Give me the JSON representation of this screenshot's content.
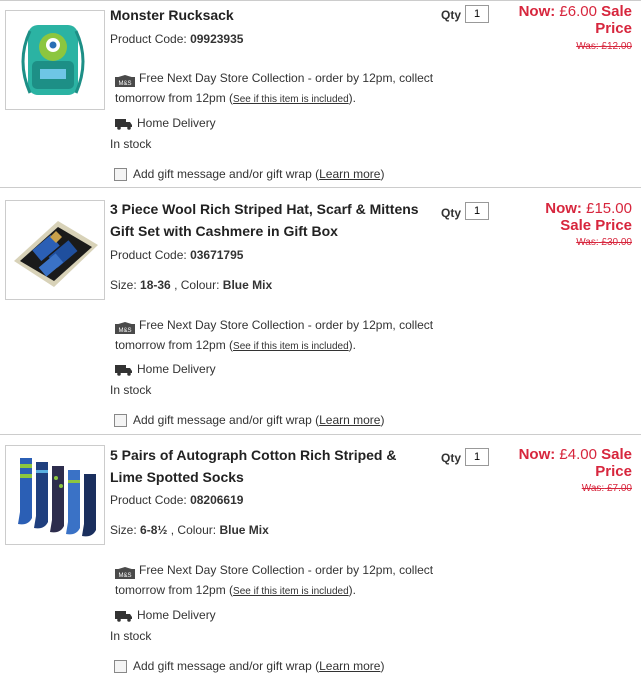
{
  "qty_label": "Qty",
  "now_label": "Now:",
  "sale_label": "Sale",
  "sale_price_label": "Sale Price",
  "was_label": "Was:",
  "product_code_label": "Product Code:",
  "collect_text_1": "Free Next Day Store Collection - order by 12pm, collect",
  "collect_text_2": "tomorrow from 12pm (",
  "collect_link": "See if this item is included",
  "collect_text_3": ").",
  "home_delivery": "Home Delivery",
  "in_stock": "In stock",
  "gift_text": "Add gift message and/or gift wrap (",
  "gift_learn": "Learn more",
  "gift_close": ")",
  "size_label": "Size:",
  "colour_label": ", Colour:",
  "ms_logo_text": "M&S",
  "colors": {
    "price_red": "#d7263d",
    "border": "#cccccc"
  },
  "items": [
    {
      "title": "Monster Rucksack",
      "code": "09923935",
      "qty": "1",
      "now_price": "£6.00",
      "was_price": "£12.00",
      "image": "rucksack"
    },
    {
      "title": "3 Piece Wool Rich Striped Hat, Scarf & Mittens Gift Set with Cashmere in Gift Box",
      "code": "03671795",
      "size": "18-36",
      "colour": "Blue Mix",
      "qty": "1",
      "now_price": "£15.00",
      "was_price": "£30.00",
      "image": "gift-box"
    },
    {
      "title": "5 Pairs of Autograph Cotton Rich Striped & Lime Spotted Socks",
      "code": "08206619",
      "size": "6-8½",
      "colour": "Blue Mix",
      "qty": "1",
      "now_price": "£4.00",
      "was_price": "£7.00",
      "image": "socks"
    }
  ]
}
